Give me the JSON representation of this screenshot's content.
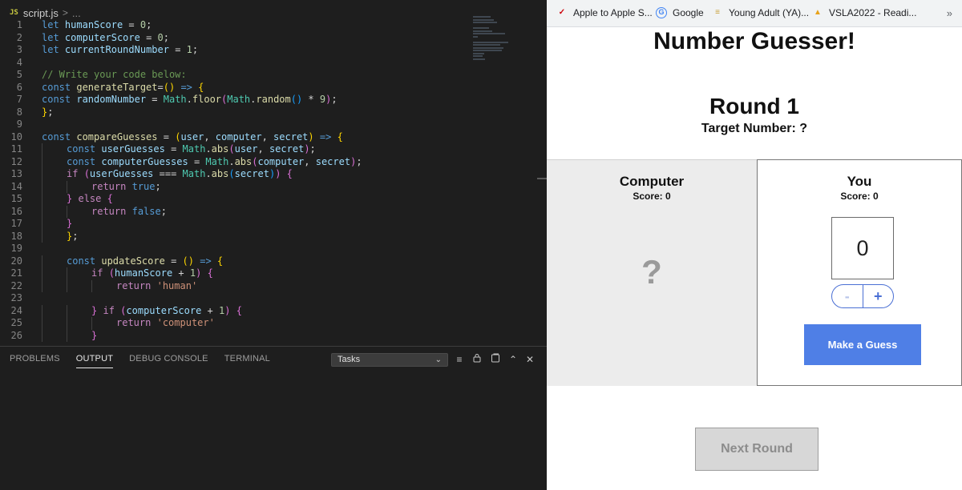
{
  "editor": {
    "file_badge": "JS",
    "file_name": "script.js",
    "breadcrumb_separator": ">",
    "breadcrumb_more": "...",
    "lines": [
      {
        "n": "1",
        "indent": 0,
        "tokens": [
          [
            "kw",
            "let"
          ],
          [
            "pl",
            " "
          ],
          [
            "var",
            "humanScore"
          ],
          [
            "pl",
            " = "
          ],
          [
            "num",
            "0"
          ],
          [
            "pl",
            ";"
          ]
        ]
      },
      {
        "n": "2",
        "indent": 0,
        "tokens": [
          [
            "kw",
            "let"
          ],
          [
            "pl",
            " "
          ],
          [
            "var",
            "computerScore"
          ],
          [
            "pl",
            " = "
          ],
          [
            "num",
            "0"
          ],
          [
            "pl",
            ";"
          ]
        ]
      },
      {
        "n": "3",
        "indent": 0,
        "tokens": [
          [
            "kw",
            "let"
          ],
          [
            "pl",
            " "
          ],
          [
            "var",
            "currentRoundNumber"
          ],
          [
            "pl",
            " = "
          ],
          [
            "num",
            "1"
          ],
          [
            "pl",
            ";"
          ]
        ]
      },
      {
        "n": "4",
        "indent": 0,
        "tokens": []
      },
      {
        "n": "5",
        "indent": 0,
        "tokens": [
          [
            "com",
            "// Write your code below:"
          ]
        ]
      },
      {
        "n": "6",
        "indent": 0,
        "tokens": [
          [
            "kw",
            "const"
          ],
          [
            "pl",
            " "
          ],
          [
            "fn",
            "generateTarget"
          ],
          [
            "pl",
            "="
          ],
          [
            "p1",
            "()"
          ],
          [
            "pl",
            " "
          ],
          [
            "kw",
            "=>"
          ],
          [
            "pl",
            " "
          ],
          [
            "p1",
            "{"
          ]
        ]
      },
      {
        "n": "7",
        "indent": 0,
        "tokens": [
          [
            "kw",
            "const"
          ],
          [
            "pl",
            " "
          ],
          [
            "var",
            "randomNumber"
          ],
          [
            "pl",
            " = "
          ],
          [
            "cls",
            "Math"
          ],
          [
            "pl",
            "."
          ],
          [
            "fn",
            "floor"
          ],
          [
            "p2",
            "("
          ],
          [
            "cls",
            "Math"
          ],
          [
            "pl",
            "."
          ],
          [
            "fn",
            "random"
          ],
          [
            "p3",
            "()"
          ],
          [
            "pl",
            " * "
          ],
          [
            "num",
            "9"
          ],
          [
            "p2",
            ")"
          ],
          [
            "pl",
            ";"
          ]
        ]
      },
      {
        "n": "8",
        "indent": 0,
        "tokens": [
          [
            "p1",
            "}"
          ],
          [
            "pl",
            ";"
          ]
        ]
      },
      {
        "n": "9",
        "indent": 0,
        "tokens": []
      },
      {
        "n": "10",
        "indent": 0,
        "tokens": [
          [
            "kw",
            "const"
          ],
          [
            "pl",
            " "
          ],
          [
            "fn",
            "compareGuesses"
          ],
          [
            "pl",
            " = "
          ],
          [
            "p1",
            "("
          ],
          [
            "var",
            "user"
          ],
          [
            "pl",
            ", "
          ],
          [
            "var",
            "computer"
          ],
          [
            "pl",
            ", "
          ],
          [
            "var",
            "secret"
          ],
          [
            "p1",
            ")"
          ],
          [
            "pl",
            " "
          ],
          [
            "kw",
            "=>"
          ],
          [
            "pl",
            " "
          ],
          [
            "p1",
            "{"
          ]
        ]
      },
      {
        "n": "11",
        "indent": 1,
        "tokens": [
          [
            "kw",
            "const"
          ],
          [
            "pl",
            " "
          ],
          [
            "var",
            "userGuesses"
          ],
          [
            "pl",
            " = "
          ],
          [
            "cls",
            "Math"
          ],
          [
            "pl",
            "."
          ],
          [
            "fn",
            "abs"
          ],
          [
            "p2",
            "("
          ],
          [
            "var",
            "user"
          ],
          [
            "pl",
            ", "
          ],
          [
            "var",
            "secret"
          ],
          [
            "p2",
            ")"
          ],
          [
            "pl",
            ";"
          ]
        ]
      },
      {
        "n": "12",
        "indent": 1,
        "tokens": [
          [
            "kw",
            "const"
          ],
          [
            "pl",
            " "
          ],
          [
            "var",
            "computerGuesses"
          ],
          [
            "pl",
            " = "
          ],
          [
            "cls",
            "Math"
          ],
          [
            "pl",
            "."
          ],
          [
            "fn",
            "abs"
          ],
          [
            "p2",
            "("
          ],
          [
            "var",
            "computer"
          ],
          [
            "pl",
            ", "
          ],
          [
            "var",
            "secret"
          ],
          [
            "p2",
            ")"
          ],
          [
            "pl",
            ";"
          ]
        ]
      },
      {
        "n": "13",
        "indent": 1,
        "tokens": [
          [
            "ctl",
            "if"
          ],
          [
            "pl",
            " "
          ],
          [
            "p2",
            "("
          ],
          [
            "var",
            "userGuesses"
          ],
          [
            "pl",
            " === "
          ],
          [
            "cls",
            "Math"
          ],
          [
            "pl",
            "."
          ],
          [
            "fn",
            "abs"
          ],
          [
            "p3",
            "("
          ],
          [
            "var",
            "secret"
          ],
          [
            "p3",
            ")"
          ],
          [
            "p2",
            ")"
          ],
          [
            "pl",
            " "
          ],
          [
            "p2",
            "{"
          ]
        ]
      },
      {
        "n": "14",
        "indent": 2,
        "tokens": [
          [
            "ctl",
            "return"
          ],
          [
            "pl",
            " "
          ],
          [
            "kw",
            "true"
          ],
          [
            "pl",
            ";"
          ]
        ]
      },
      {
        "n": "15",
        "indent": 1,
        "tokens": [
          [
            "p2",
            "}"
          ],
          [
            "pl",
            " "
          ],
          [
            "ctl",
            "else"
          ],
          [
            "pl",
            " "
          ],
          [
            "p2",
            "{"
          ]
        ]
      },
      {
        "n": "16",
        "indent": 2,
        "tokens": [
          [
            "ctl",
            "return"
          ],
          [
            "pl",
            " "
          ],
          [
            "kw",
            "false"
          ],
          [
            "pl",
            ";"
          ]
        ]
      },
      {
        "n": "17",
        "indent": 1,
        "tokens": [
          [
            "p2",
            "}"
          ]
        ]
      },
      {
        "n": "18",
        "indent": 1,
        "tokens": [
          [
            "p1",
            "}"
          ],
          [
            "pl",
            ";"
          ]
        ]
      },
      {
        "n": "19",
        "indent": 0,
        "tokens": []
      },
      {
        "n": "20",
        "indent": 1,
        "tokens": [
          [
            "kw",
            "const"
          ],
          [
            "pl",
            " "
          ],
          [
            "fn",
            "updateScore"
          ],
          [
            "pl",
            " = "
          ],
          [
            "p1",
            "()"
          ],
          [
            "pl",
            " "
          ],
          [
            "kw",
            "=>"
          ],
          [
            "pl",
            " "
          ],
          [
            "p1",
            "{"
          ]
        ]
      },
      {
        "n": "21",
        "indent": 2,
        "tokens": [
          [
            "ctl",
            "if"
          ],
          [
            "pl",
            " "
          ],
          [
            "p2",
            "("
          ],
          [
            "var",
            "humanScore"
          ],
          [
            "pl",
            " + "
          ],
          [
            "num",
            "1"
          ],
          [
            "p2",
            ")"
          ],
          [
            "pl",
            " "
          ],
          [
            "p2",
            "{"
          ]
        ]
      },
      {
        "n": "22",
        "indent": 3,
        "tokens": [
          [
            "ctl",
            "return"
          ],
          [
            "pl",
            " "
          ],
          [
            "str",
            "'human'"
          ]
        ]
      },
      {
        "n": "23",
        "indent": 0,
        "tokens": []
      },
      {
        "n": "24",
        "indent": 2,
        "tokens": [
          [
            "p2",
            "}"
          ],
          [
            "pl",
            " "
          ],
          [
            "ctl",
            "if"
          ],
          [
            "pl",
            " "
          ],
          [
            "p2",
            "("
          ],
          [
            "var",
            "computerScore"
          ],
          [
            "pl",
            " + "
          ],
          [
            "num",
            "1"
          ],
          [
            "p2",
            ")"
          ],
          [
            "pl",
            " "
          ],
          [
            "p2",
            "{"
          ]
        ]
      },
      {
        "n": "25",
        "indent": 3,
        "tokens": [
          [
            "ctl",
            "return"
          ],
          [
            "pl",
            " "
          ],
          [
            "str",
            "'computer'"
          ]
        ]
      },
      {
        "n": "26",
        "indent": 2,
        "tokens": [
          [
            "p2",
            "}"
          ]
        ]
      }
    ]
  },
  "panel": {
    "tabs": [
      "PROBLEMS",
      "OUTPUT",
      "DEBUG CONSOLE",
      "TERMINAL"
    ],
    "active_tab": "OUTPUT",
    "tasks_select_value": "Tasks"
  },
  "browser": {
    "bookmarks": [
      {
        "label": "Apple to Apple S...",
        "icon": "verizon-check-icon",
        "color": "#cd040b"
      },
      {
        "label": "Google",
        "icon": "google-g-icon",
        "color": "#4285f4"
      },
      {
        "label": "Young Adult (YA)...",
        "icon": "stack-icon",
        "color": "#c8a13b"
      },
      {
        "label": "VSLA2022 - Readi...",
        "icon": "reading-icon",
        "color": "#e8a31b"
      }
    ],
    "bookmarks_more": "»"
  },
  "game": {
    "title": "Number Guesser!",
    "round_label": "Round 1",
    "target_label": "Target Number: ?",
    "computer": {
      "name": "Computer",
      "score_label": "Score: 0",
      "guess": "?"
    },
    "human": {
      "name": "You",
      "score_label": "Score: 0",
      "guess_value": "0"
    },
    "minus_label": "-",
    "plus_label": "+",
    "guess_button": "Make a Guess",
    "next_button": "Next Round",
    "accent_color": "#4f7fe6"
  }
}
